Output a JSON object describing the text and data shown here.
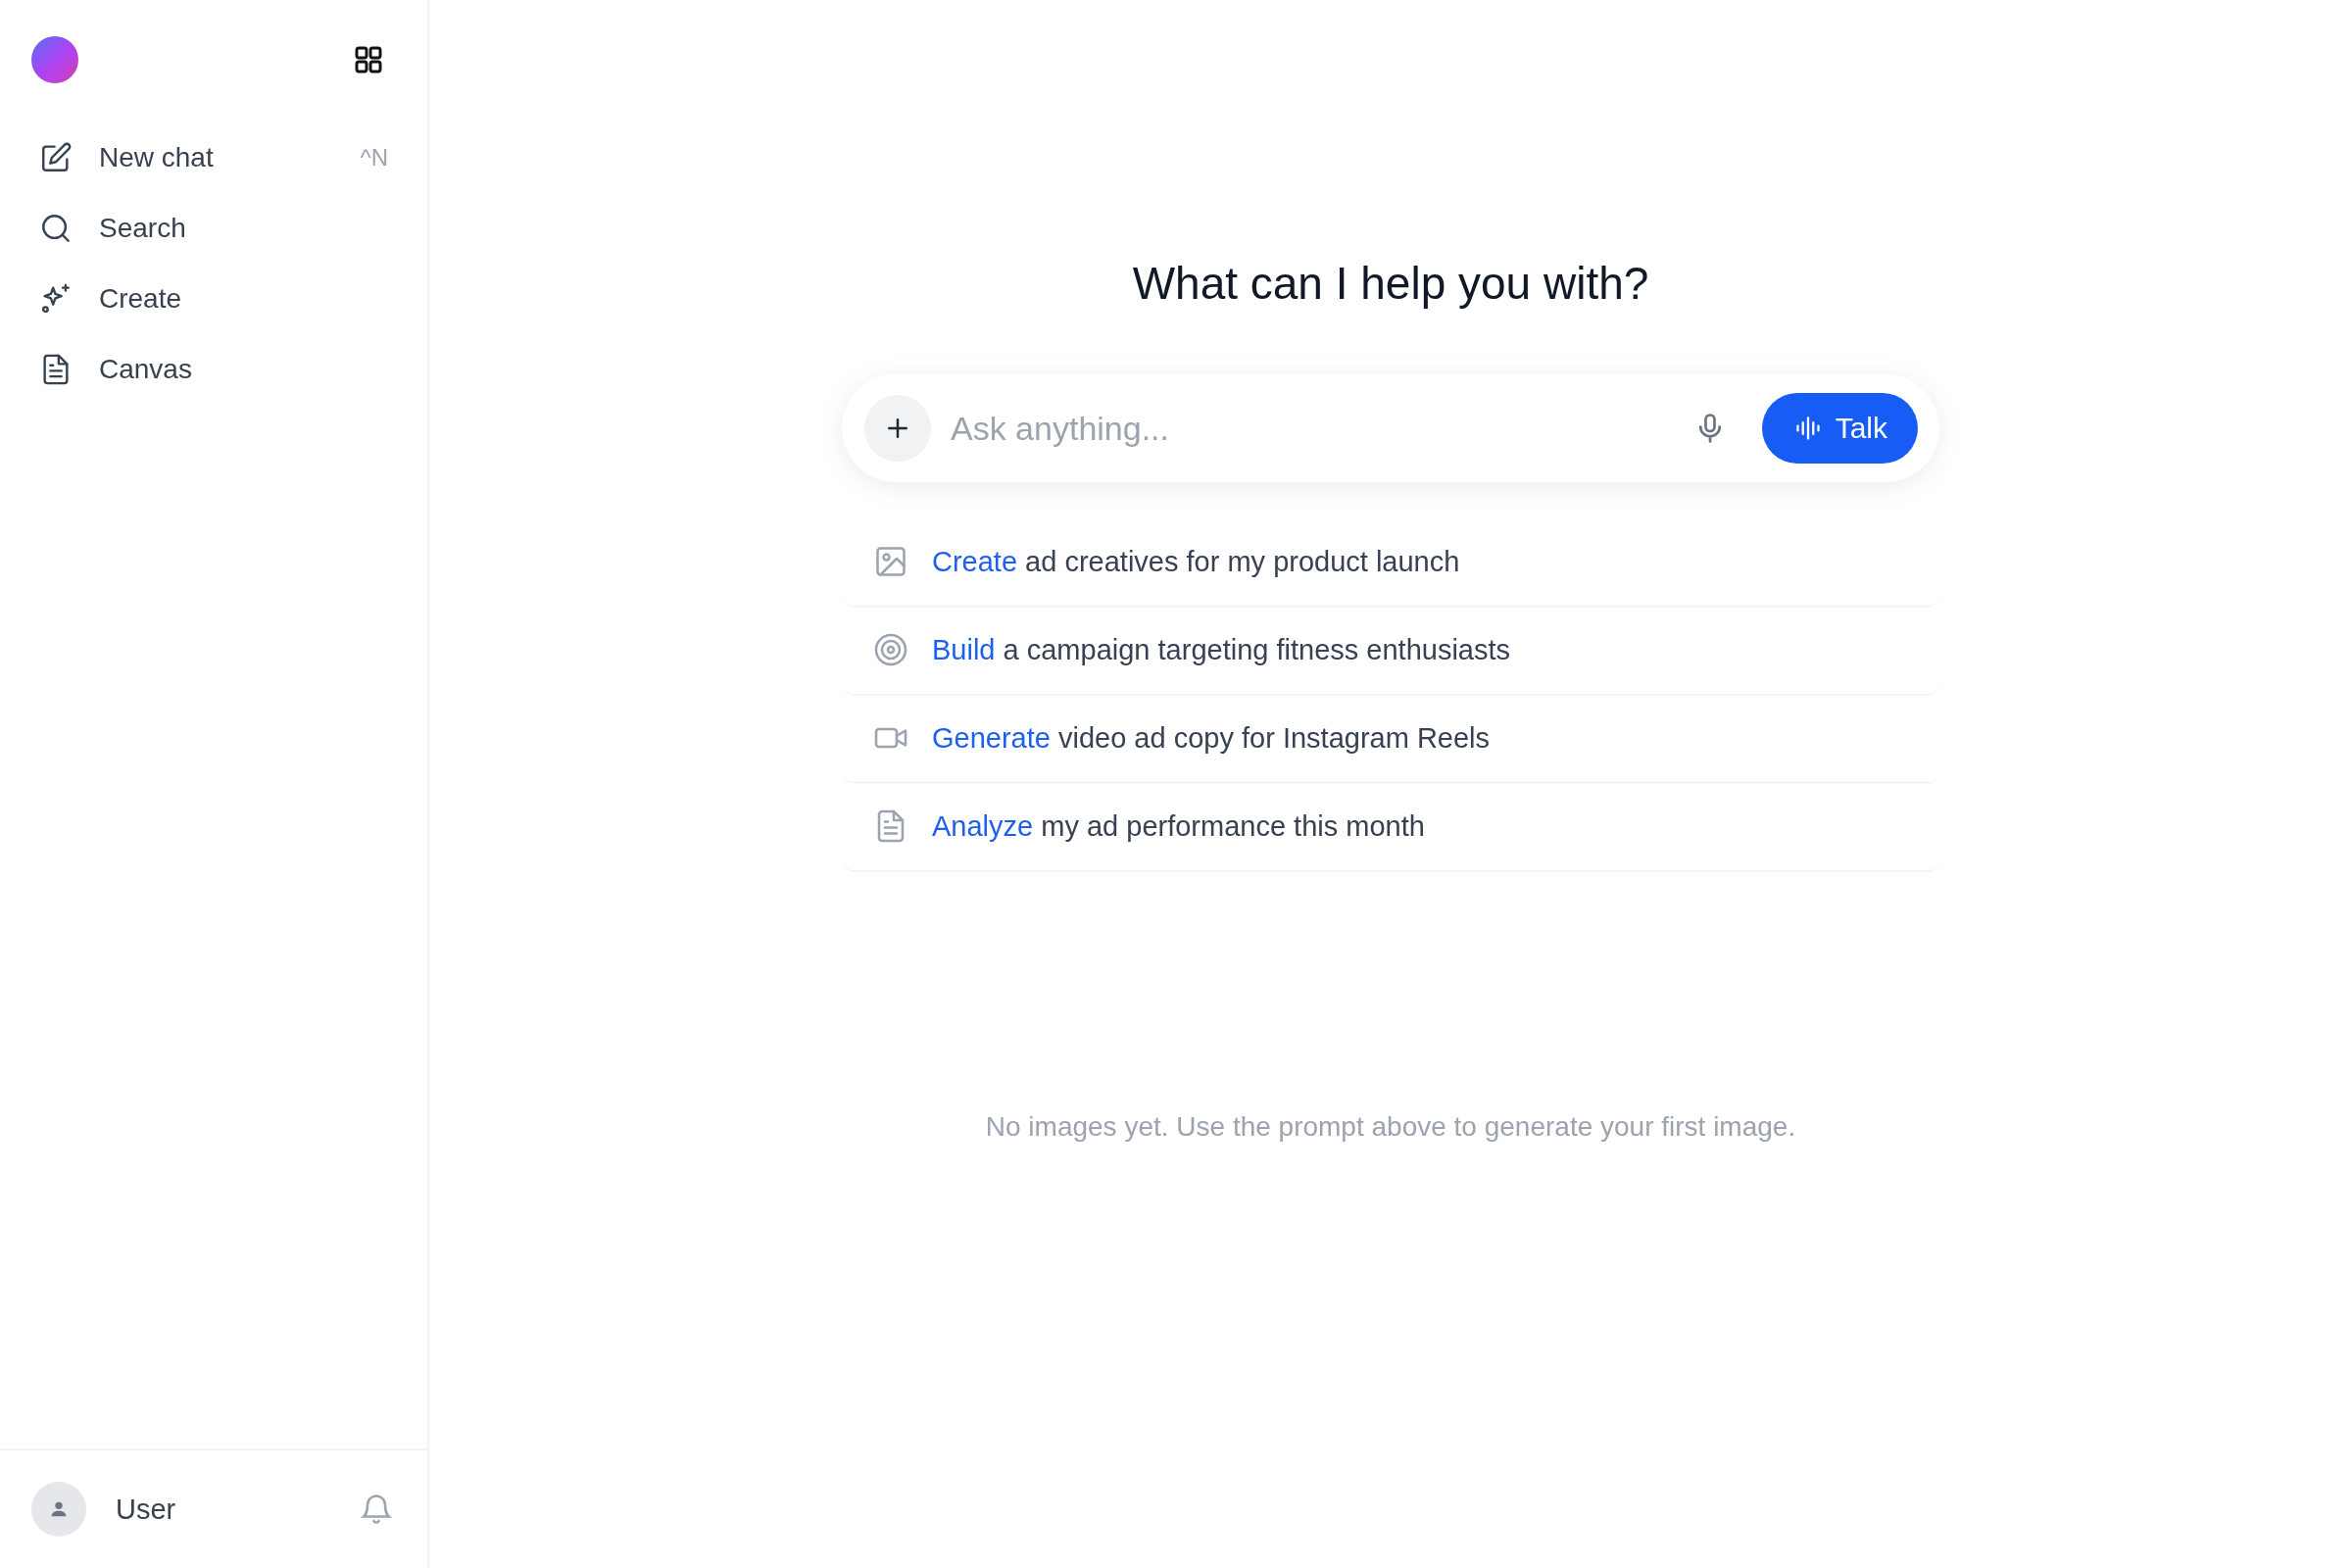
{
  "sidebar": {
    "items": [
      {
        "kind": "edit",
        "label": "New chat",
        "shortcut": "^N"
      },
      {
        "kind": "search",
        "label": "Search"
      },
      {
        "kind": "sparkle",
        "label": "Create"
      },
      {
        "kind": "document",
        "label": "Canvas"
      }
    ],
    "user": {
      "name": "User"
    }
  },
  "main": {
    "heading": "What can I help you with?",
    "prompt": {
      "placeholder": "Ask anything...",
      "talk_button": "Talk"
    },
    "suggestions": [
      {
        "kind": "image",
        "verb": "Create",
        "text": "ad creatives for my product launch"
      },
      {
        "kind": "target",
        "verb": "Build",
        "text": "a campaign targeting fitness enthusiasts"
      },
      {
        "kind": "video",
        "verb": "Generate",
        "text": "video ad copy for Instagram Reels"
      },
      {
        "kind": "document",
        "verb": "Analyze",
        "text": "my ad performance this month"
      }
    ],
    "empty_message": "No images yet. Use the prompt above to generate your first image."
  }
}
